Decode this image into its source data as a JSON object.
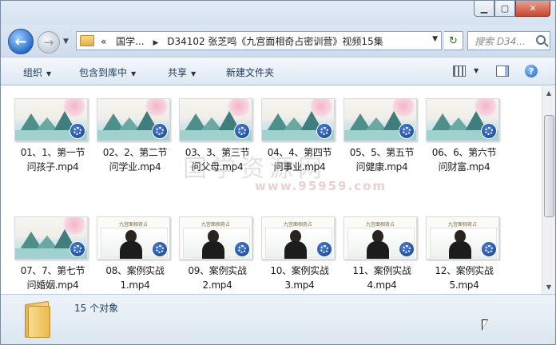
{
  "window": {
    "minimize_label": "▁",
    "maximize_label": "▢",
    "close_label": "✕"
  },
  "nav": {
    "back_label": "←",
    "forward_label": "→",
    "history_label": "▼"
  },
  "address": {
    "prefix": "«",
    "crumb1": "国学...",
    "sep": "▶",
    "crumb2": "D34102 张芝鸣《九宫面相奇占密训营》视频15集",
    "dropdown": "▼"
  },
  "refresh_label": "↻",
  "search": {
    "placeholder": "搜索 D34..."
  },
  "toolbar": {
    "organize": "组织",
    "include_library": "包含到库中",
    "share": "共享",
    "new_folder": "新建文件夹",
    "dropdown_arrow": "▼",
    "help": "?"
  },
  "watermark": {
    "text": "国学资源网",
    "url": "www.95959.com"
  },
  "files": [
    {
      "line1": "01、1、第一节",
      "line2": "问孩子.mp4",
      "thumb": "landscape"
    },
    {
      "line1": "02、2、第二节",
      "line2": "问学业.mp4",
      "thumb": "landscape"
    },
    {
      "line1": "03、3、第三节",
      "line2": "问父母.mp4",
      "thumb": "landscape"
    },
    {
      "line1": "04、4、第四节",
      "line2": "问事业.mp4",
      "thumb": "landscape"
    },
    {
      "line1": "05、5、第五节",
      "line2": "问健康.mp4",
      "thumb": "landscape"
    },
    {
      "line1": "06、6、第六节",
      "line2": "问财富.mp4",
      "thumb": "landscape"
    },
    {
      "line1": "07、7、第七节",
      "line2": "问婚姻.mp4",
      "thumb": "landscape"
    },
    {
      "line1": "08、案例实战",
      "line2": "1.mp4",
      "thumb": "lecture",
      "banner": "九宫面相奇占"
    },
    {
      "line1": "09、案例实战",
      "line2": "2.mp4",
      "thumb": "lecture",
      "banner": "九宫面相奇占"
    },
    {
      "line1": "10、案例实战",
      "line2": "3.mp4",
      "thumb": "lecture",
      "banner": "九宫面相奇占"
    },
    {
      "line1": "11、案例实战",
      "line2": "4.mp4",
      "thumb": "lecture",
      "banner": "九宫面相奇占"
    },
    {
      "line1": "12、案例实战",
      "line2": "5.mp4",
      "thumb": "lecture",
      "banner": "九宫面相奇占"
    }
  ],
  "scrollbar": {
    "up": "▲",
    "down": "▼"
  },
  "details": {
    "count_text": "15 个对象"
  }
}
